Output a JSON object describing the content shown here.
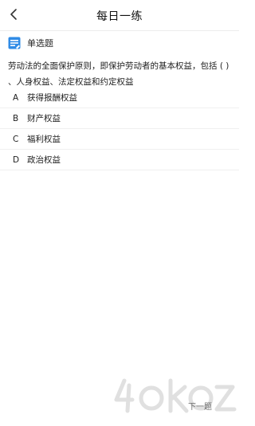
{
  "header": {
    "back_icon": "chevron-left-icon",
    "title": "每日一练"
  },
  "question": {
    "type_icon": "question-list-icon",
    "type_label": "单选题",
    "text": "劳动法的全面保护原则，即保护劳动者的基本权益，包括 ( ) 、人身权益、法定权益和约定权益"
  },
  "options": [
    {
      "letter": "A",
      "text": "获得报酬权益"
    },
    {
      "letter": "B",
      "text": "财产权益"
    },
    {
      "letter": "C",
      "text": "福利权益"
    },
    {
      "letter": "D",
      "text": "政治权益"
    }
  ],
  "footer": {
    "next_label": "下一题"
  },
  "colors": {
    "accent": "#2f8be6",
    "background": "#ffffff",
    "divider": "#ececec"
  }
}
